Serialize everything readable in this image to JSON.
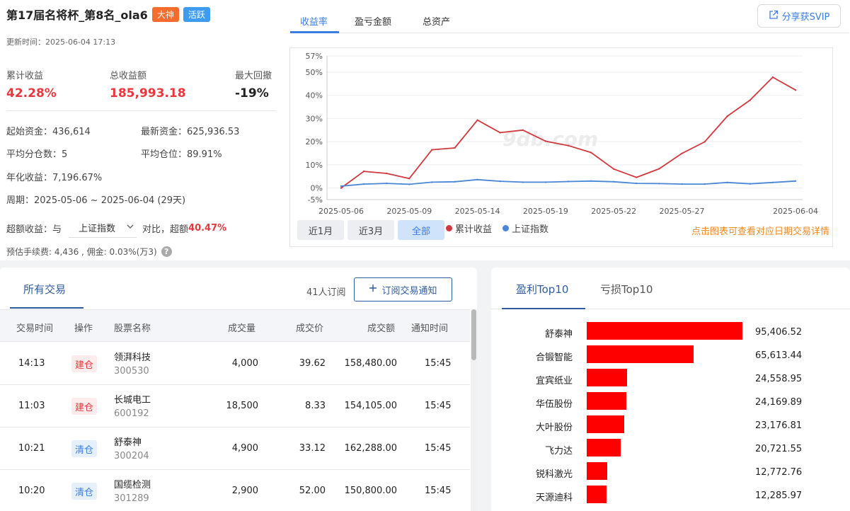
{
  "profile": {
    "title": "第17届名将杯_第8名_ola6",
    "tags": [
      "大神",
      "活跃"
    ],
    "updated": "更新时间：2025-06-04 17:13"
  },
  "stats": [
    {
      "label": "累计收益",
      "value": "42.28%"
    },
    {
      "label": "总收益额",
      "value": "185,993.18"
    },
    {
      "label": "最大回撤",
      "value": "-19%"
    }
  ],
  "info": {
    "start_capital": "起始资金：436,614",
    "latest_capital": "最新资金：625,936.53",
    "avg_split": "平均分仓数：5",
    "avg_position": "平均仓位：89.91%",
    "annual": "年化收益：7,196.67%",
    "period": "周期：2025-05-06 ~ 2025-06-04 (29天)"
  },
  "benchmark": {
    "prefix": "超额收益：与",
    "selected": "上证指数",
    "middle": "对比，超额",
    "excess": "40.47%"
  },
  "fee": "预估手续费: 4,436 , 佣金: 0.03%(万3)",
  "chart_tabs": [
    "收益率",
    "盈亏金额",
    "总资产"
  ],
  "share_label": "分享获SVIP",
  "range_buttons": [
    "近1月",
    "近3月",
    "全部"
  ],
  "legend": [
    "累计收益",
    "上证指数"
  ],
  "chart_hint": "点击图表可查看对应日期交易详情",
  "watermark": "9db.com",
  "colors": {
    "profit_red": "#e8383d",
    "index_blue": "#4a86d8",
    "accent": "#3a7ee0",
    "bar_red": "#fe0000"
  },
  "chart_data": {
    "type": "line",
    "y_ticks": [
      "57%",
      "50%",
      "40%",
      "30%",
      "20%",
      "10%",
      "0%",
      "-5%"
    ],
    "x_ticks": [
      "2025-05-06",
      "2025-05-09",
      "2025-05-14",
      "2025-05-19",
      "2025-05-22",
      "2025-05-27",
      "2025-06-04"
    ],
    "ylim": [
      -5,
      57
    ],
    "series": [
      {
        "name": "累计收益",
        "color": "#d0393e",
        "values": [
          0,
          7.2,
          6.3,
          4.1,
          16.5,
          17.3,
          29.3,
          23.9,
          25.0,
          20.2,
          18.3,
          15.3,
          8.2,
          4.6,
          8.3,
          14.9,
          19.9,
          31.0,
          37.9,
          47.8,
          42.28
        ]
      },
      {
        "name": "上证指数",
        "color": "#4a86d8",
        "values": [
          0.8,
          1.7,
          2.0,
          1.6,
          2.5,
          2.7,
          3.6,
          2.9,
          2.5,
          2.5,
          2.8,
          3.0,
          2.7,
          2.0,
          1.9,
          1.7,
          1.7,
          2.4,
          1.8,
          2.4,
          3.0
        ]
      }
    ]
  },
  "trades": {
    "tab": "所有交易",
    "subscribers": "41人订阅",
    "subscribe_btn": "订阅交易通知",
    "columns": [
      "交易时间",
      "操作",
      "股票名称",
      "成交量",
      "成交价",
      "成交额",
      "通知时间"
    ],
    "rows": [
      {
        "time": "14:13",
        "op": "建仓",
        "name": "领湃科技",
        "code": "300530",
        "volume": "4,000",
        "price": "39.62",
        "amount": "158,480.00",
        "notify": "15:45"
      },
      {
        "time": "11:03",
        "op": "建仓",
        "name": "长城电工",
        "code": "600192",
        "volume": "18,500",
        "price": "8.33",
        "amount": "154,105.00",
        "notify": "15:45"
      },
      {
        "time": "10:21",
        "op": "清仓",
        "name": "舒泰神",
        "code": "300204",
        "volume": "4,900",
        "price": "33.12",
        "amount": "162,288.00",
        "notify": "15:45"
      },
      {
        "time": "10:20",
        "op": "清仓",
        "name": "国缆检测",
        "code": "301289",
        "volume": "2,900",
        "price": "52.00",
        "amount": "150,800.00",
        "notify": "15:45"
      }
    ]
  },
  "top10": {
    "tabs": [
      "盈利Top10",
      "亏损Top10"
    ],
    "items": [
      {
        "name": "舒泰神",
        "value": "95,406.52",
        "num": 95406.52
      },
      {
        "name": "合锻智能",
        "value": "65,613.44",
        "num": 65613.44
      },
      {
        "name": "宜宾纸业",
        "value": "24,558.95",
        "num": 24558.95
      },
      {
        "name": "华伍股份",
        "value": "24,169.89",
        "num": 24169.89
      },
      {
        "name": "大叶股份",
        "value": "23,176.81",
        "num": 23176.81
      },
      {
        "name": "飞力达",
        "value": "20,721.55",
        "num": 20721.55
      },
      {
        "name": "锐科激光",
        "value": "12,772.76",
        "num": 12772.76
      },
      {
        "name": "天源迪科",
        "value": "12,285.97",
        "num": 12285.97
      }
    ]
  }
}
